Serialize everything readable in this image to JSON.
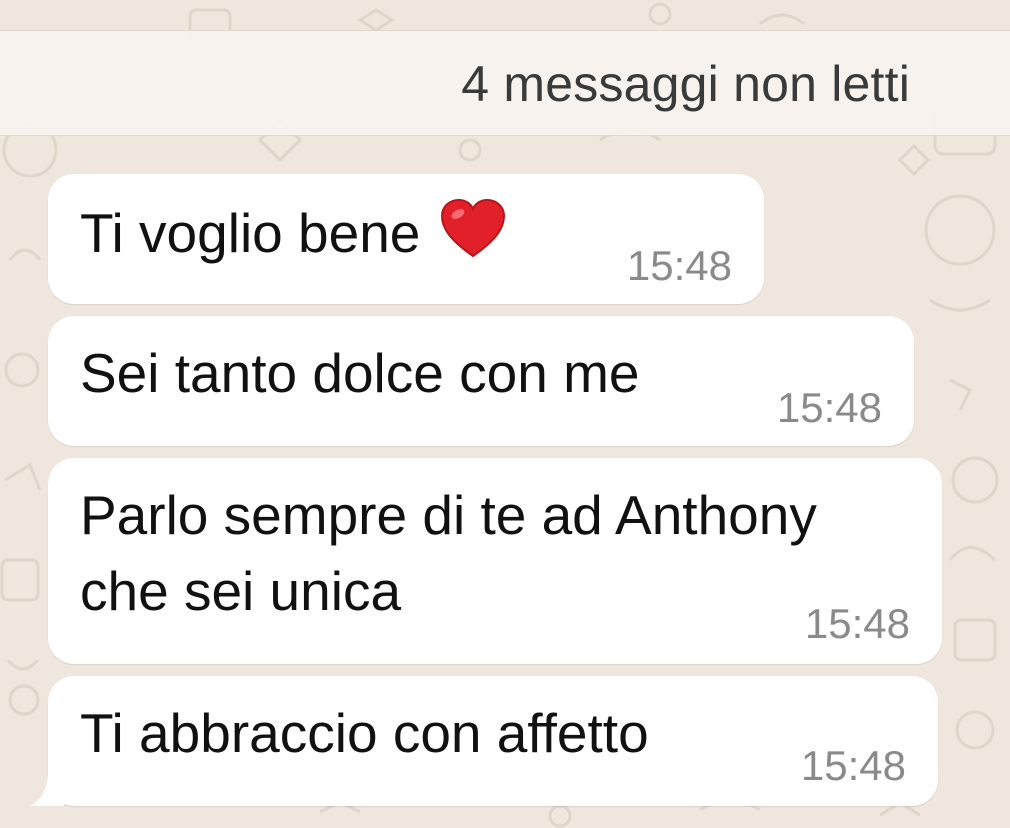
{
  "unread_separator": {
    "label": "4 messaggi non letti"
  },
  "messages": [
    {
      "text": "Ti voglio bene",
      "emoji_icon": "red-heart-icon",
      "time": "15:48"
    },
    {
      "text": "Sei tanto dolce con me",
      "time": "15:48"
    },
    {
      "lines": [
        "Parlo sempre di te ad Anthony",
        "che sei unica"
      ],
      "time": "15:48"
    },
    {
      "text": "Ti abbraccio con affetto",
      "time": "15:48"
    }
  ],
  "colors": {
    "background": "#efe7dd",
    "bubble": "#ffffff",
    "time_text": "#8a8a8a",
    "heart": "#e2202a"
  }
}
